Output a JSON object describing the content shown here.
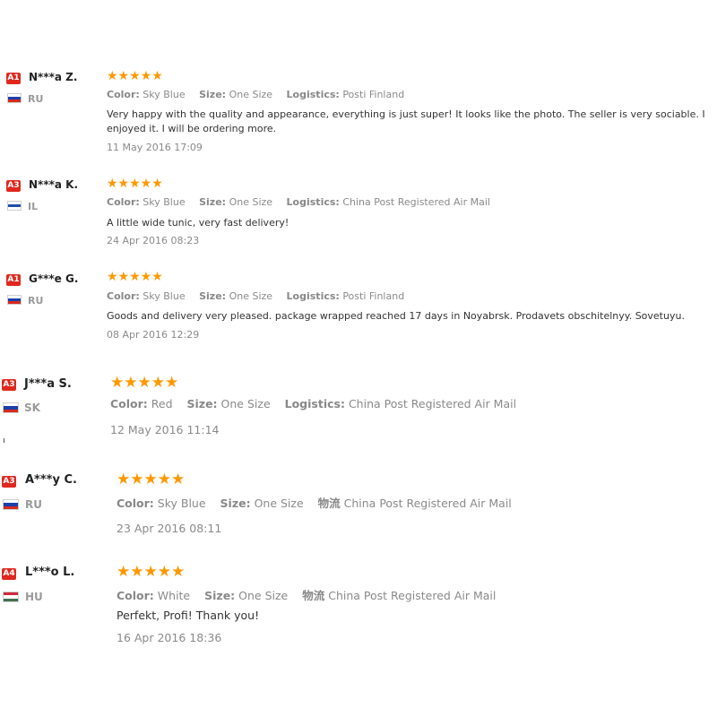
{
  "reviews": [
    {
      "badge": "A1",
      "name": "N***a Z.",
      "country": "RU",
      "flag": "ru",
      "stars": "★★★★★",
      "color_label": "Color:",
      "color": "Sky Blue",
      "size_label": "Size:",
      "size": "One Size",
      "logistics_label": "Logistics:",
      "logistics": "Posti Finland",
      "content": "Very happy with the quality and appearance, everything is just super! It looks like the photo. The seller is very sociable. I enjoyed it. I will be ordering more.",
      "date": "11 May 2016 17:09"
    },
    {
      "badge": "A3",
      "name": "N***a K.",
      "country": "IL",
      "flag": "il",
      "stars": "★★★★★",
      "color_label": "Color:",
      "color": "Sky Blue",
      "size_label": "Size:",
      "size": "One Size",
      "logistics_label": "Logistics:",
      "logistics": "China Post Registered Air Mail",
      "content": "A little wide tunic, very fast delivery!",
      "date": "24 Apr 2016 08:23"
    },
    {
      "badge": "A1",
      "name": "G***e G.",
      "country": "RU",
      "flag": "ru",
      "stars": "★★★★★",
      "color_label": "Color:",
      "color": "Sky Blue",
      "size_label": "Size:",
      "size": "One Size",
      "logistics_label": "Logistics:",
      "logistics": "Posti Finland",
      "content": "Goods and delivery very pleased. package wrapped reached 17 days in Noyabrsk. Prodavets obschitelnyy. Sovetuyu.",
      "date": "08 Apr 2016 12:29"
    },
    {
      "badge": "A3",
      "name": "J***a S.",
      "country": "SK",
      "flag": "sk",
      "stars": "★★★★★",
      "color_label": "Color:",
      "color": "Red",
      "size_label": "Size:",
      "size": "One Size",
      "logistics_label": "Logistics:",
      "logistics": "China Post Registered Air Mail",
      "content": "",
      "date": "12 May 2016 11:14"
    },
    {
      "badge": "A3",
      "name": "A***y C.",
      "country": "RU",
      "flag": "ru",
      "stars": "★★★★★",
      "color_label": "Color:",
      "color": "Sky Blue",
      "size_label": "Size:",
      "size": "One Size",
      "logistics_label": "物流",
      "logistics": "China Post Registered Air Mail",
      "content": "",
      "date": "23 Apr 2016 08:11"
    },
    {
      "badge": "A4",
      "name": "L***o L.",
      "country": "HU",
      "flag": "hu",
      "stars": "★★★★★",
      "color_label": "Color:",
      "color": "White",
      "size_label": "Size:",
      "size": "One Size",
      "logistics_label": "物流",
      "logistics": "China Post Registered Air Mail",
      "content": "Perfekt, Profi! Thank you!",
      "date": "16 Apr 2016 18:36"
    }
  ],
  "flag_colors": {
    "ru": [
      "#ffffff",
      "#1c3faa",
      "#d52b1e"
    ],
    "il": [
      "#ffffff",
      "#1f4fa8",
      "#ffffff"
    ],
    "sk": [
      "#ffffff",
      "#1c3faa",
      "#d52b1e"
    ],
    "hu": [
      "#cd2a3e",
      "#ffffff",
      "#436f4d"
    ]
  },
  "colors": {
    "badge": "#e0281e",
    "star": "#ff9800",
    "meta": "#8a8a8a"
  }
}
